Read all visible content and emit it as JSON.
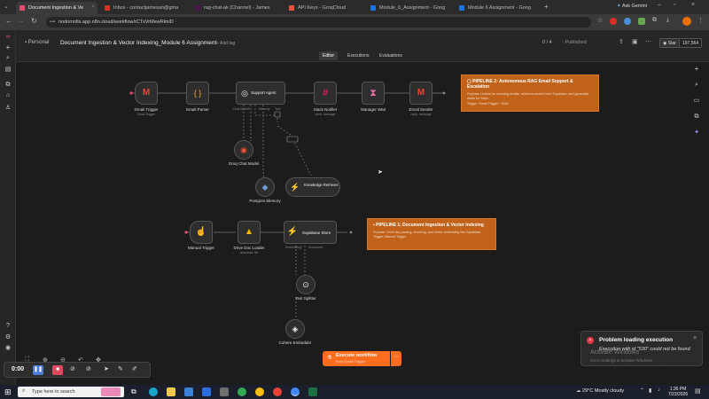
{
  "browser": {
    "tabs": [
      {
        "label": "Document Ingestion & Ve",
        "color": "#ea4b71",
        "active": true
      },
      {
        "label": "Inbox - contactjamesan@gma",
        "color": "#d93025"
      },
      {
        "label": "rag-chat-ak (Channel) - James",
        "color": "#4a154b"
      },
      {
        "label": "API Keys - GroqCloud",
        "color": "#f55036"
      },
      {
        "label": "Module_6_Assignment - Goog",
        "color": "#1a73e8"
      },
      {
        "label": "Module 6 Assignment - Goog",
        "color": "#1a73e8"
      }
    ],
    "new_tab": "+",
    "ask_gemini": "Ask Gemini",
    "url": "nodomnfis.app.n8n.cloud/workflow/rCTxVrMewRlmiD",
    "accent": "#ea4b71"
  },
  "header": {
    "workspace": "Personal",
    "workflow_title": "Document Ingestion & Vector Indexing_Module 6 Assignment",
    "add_tag": "+ Add tag",
    "counter": "0 / 4",
    "status": "Published",
    "star_label": "Star",
    "star_count": "197,564",
    "tabs": [
      "Editor",
      "Executions",
      "Evaluations"
    ]
  },
  "pipeline2": {
    "nodes": [
      {
        "name": "Gmail Trigger",
        "sub": "Gmail Trigger",
        "icon": "M"
      },
      {
        "name": "Email Parser",
        "sub": "",
        "icon": "{ }"
      },
      {
        "name": "Support Agent",
        "sub": "",
        "icon": "◎"
      },
      {
        "name": "Slack Notifier",
        "sub": "send: message",
        "icon": "#"
      },
      {
        "name": "Manager Wait",
        "sub": "",
        "icon": "⧗"
      },
      {
        "name": "Email Sender",
        "sub": "reply: message",
        "icon": "M"
      }
    ],
    "sub_nodes": [
      {
        "name": "Groq Chat Model",
        "icon": "◉"
      },
      {
        "name": "Postgres Memory",
        "icon": "◆"
      },
      {
        "name": "Knowledge Retriever",
        "icon": "✦"
      }
    ],
    "connector_labels": [
      "Chat Model*",
      "Memory",
      "Tool"
    ],
    "sticky": {
      "title": "PIPELINE 2: Autonomous RAG Email Support & Escalation",
      "desc": "Purpose: Listens for incoming emails, retrieves context from Supabase, and generates drafts for Slack.",
      "trigger": "Trigger: Gmail Trigger + RAG"
    }
  },
  "pipeline1": {
    "nodes": [
      {
        "name": "Manual Trigger",
        "sub": "",
        "icon": "☝"
      },
      {
        "name": "Drive Doc Loader",
        "sub": "download: file",
        "icon": "▲"
      },
      {
        "name": "Supabase Store",
        "sub": "",
        "icon": "⚡"
      },
      {
        "name": "Text Splitter",
        "sub": "",
        "icon": "⊙"
      },
      {
        "name": "Cohere Embedder",
        "sub": "",
        "icon": "◈"
      }
    ],
    "connector_labels": [
      "Embedding*",
      "Document"
    ],
    "sticky": {
      "title": "PIPELINE 1: Document Ingestion & Vector Indexing",
      "desc": "Purpose: Drive doc parsing, chunking, and vector embedding into Supabase.",
      "trigger": "Trigger: Manual Trigger"
    }
  },
  "execute_button": {
    "label": "Execute workflow",
    "sub": "from Gmail Trigger"
  },
  "recorder": {
    "time": "0:00"
  },
  "toast": {
    "title": "Problem loading execution",
    "message": "Execution with id \"530\" could not be found"
  },
  "watermark": {
    "line1": "Activate Windows",
    "line2": "Go to Settings to activate Windows."
  },
  "taskbar": {
    "search_placeholder": "Type here to search",
    "weather": "29°C  Mostly cloudy",
    "time": "1:36 PM",
    "date": "7/23/2026"
  },
  "colors": {
    "sticky": "#c0621a",
    "execute": "#ff6d1f",
    "error": "#e6384b"
  }
}
